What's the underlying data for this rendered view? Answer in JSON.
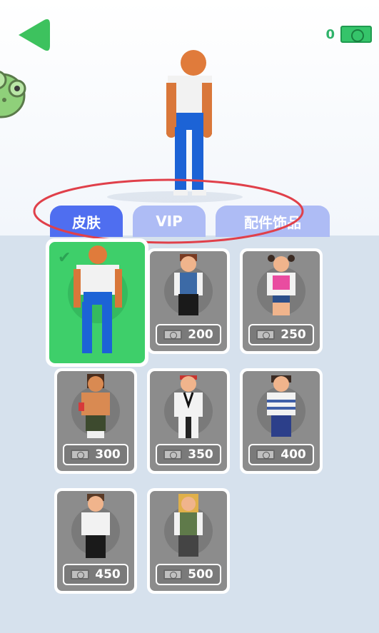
{
  "currency": {
    "balance": "0"
  },
  "tabs": {
    "skin": "皮肤",
    "vip": "VIP",
    "accessories": "配件饰品"
  },
  "skins": [
    {
      "id": "default",
      "selected": true
    },
    {
      "id": "brown-hair",
      "price": "200"
    },
    {
      "id": "pink-top",
      "price": "250"
    },
    {
      "id": "fighter",
      "price": "300"
    },
    {
      "id": "karate",
      "price": "350"
    },
    {
      "id": "sailor",
      "price": "400"
    },
    {
      "id": "white-tee",
      "price": "450"
    },
    {
      "id": "blonde",
      "price": "500"
    }
  ],
  "colors": {
    "selected_card": "#3ecf6a",
    "active_tab": "#4f6ef0",
    "inactive_tab": "#aebcf5",
    "panel": "#d6e1ed"
  }
}
